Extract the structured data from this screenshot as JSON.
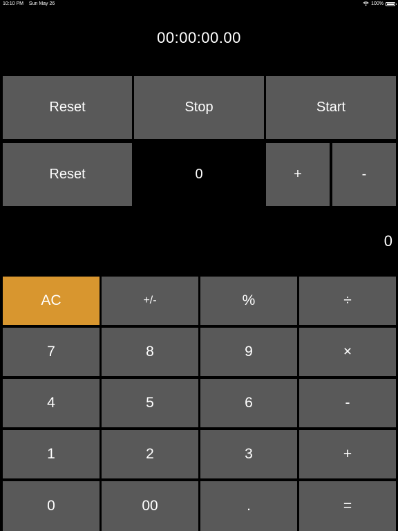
{
  "status_bar": {
    "time": "10:10 PM",
    "date": "Sun May 26",
    "battery": "100%",
    "battery_level": 1.0,
    "wifi_icon": "wifi-icon",
    "battery_icon": "battery-icon"
  },
  "stopwatch": {
    "display": "00:00:00.00",
    "reset_label": "Reset",
    "stop_label": "Stop",
    "start_label": "Start"
  },
  "counter": {
    "reset_label": "Reset",
    "value": "0",
    "increment_label": "+",
    "decrement_label": "-"
  },
  "calculator": {
    "display": "0",
    "keys": {
      "ac": "AC",
      "plus_minus": "+/-",
      "percent": "%",
      "divide": "÷",
      "seven": "7",
      "eight": "8",
      "nine": "9",
      "multiply": "×",
      "four": "4",
      "five": "5",
      "six": "6",
      "minus": "-",
      "one": "1",
      "two": "2",
      "three": "3",
      "plus": "+",
      "zero": "0",
      "double_zero": "00",
      "decimal": ".",
      "equals": "="
    }
  },
  "colors": {
    "background": "#000000",
    "button": "#595959",
    "accent": "#d8962f",
    "text": "#ffffff"
  }
}
